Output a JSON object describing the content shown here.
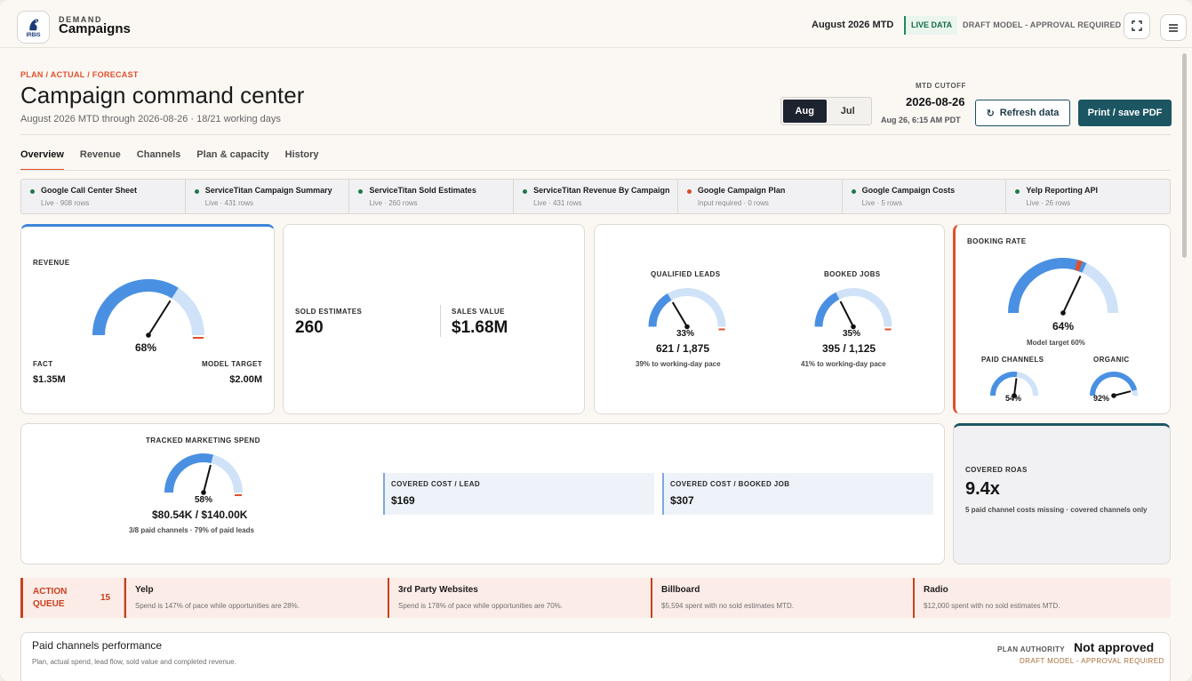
{
  "header": {
    "logo_tag": "IRBIS",
    "brand_small": "DEMAND",
    "brand_big": "Campaigns",
    "period": "August 2026 MTD",
    "live": "LIVE DATA",
    "draft": "DRAFT MODEL - APPROVAL REQUIRED",
    "icons": [
      "fullscreen-icon",
      "menu-icon"
    ]
  },
  "page": {
    "eyebrow": "PLAN / ACTUAL / FORECAST",
    "title": "Campaign command center",
    "subtitle": "August 2026 MTD through 2026-08-26 · 18/21 working days",
    "months": [
      "Aug",
      "Jul"
    ],
    "active_month": "Aug",
    "cutoff_label": "MTD CUTOFF",
    "cutoff_date": "2026-08-26",
    "cutoff_time": "Aug 26, 6:15 AM PDT",
    "refresh_label": "Refresh data",
    "refresh_icon": "↻",
    "print_label": "Print / save PDF"
  },
  "tabs": [
    "Overview",
    "Revenue",
    "Channels",
    "Plan & capacity",
    "History"
  ],
  "active_tab": "Overview",
  "sources": [
    {
      "name": "Google Call Center Sheet",
      "status": "Live · 908 rows",
      "ok": true
    },
    {
      "name": "ServiceTitan Campaign Summary",
      "status": "Live · 431 rows",
      "ok": true
    },
    {
      "name": "ServiceTitan Sold Estimates",
      "status": "Live · 260 rows",
      "ok": true
    },
    {
      "name": "ServiceTitan Revenue By Campaign",
      "status": "Live · 431 rows",
      "ok": true
    },
    {
      "name": "Google Campaign Plan",
      "status": "Input required · 0 rows",
      "ok": false
    },
    {
      "name": "Google Campaign Costs",
      "status": "Live · 5 rows",
      "ok": true
    },
    {
      "name": "Yelp Reporting API",
      "status": "Live · 26 rows",
      "ok": true
    }
  ],
  "revenue": {
    "label": "REVENUE",
    "pct_label": "68%",
    "pct": 0.68,
    "target_mark": 1.0,
    "fact_label": "FACT",
    "fact_value": "$1.35M",
    "target_label": "MODEL TARGET",
    "target_value": "$2.00M"
  },
  "sold": {
    "est_label": "SOLD ESTIMATES",
    "est_value": "260",
    "sales_label": "SALES VALUE",
    "sales_value": "$1.68M"
  },
  "leads": {
    "label": "QUALIFIED LEADS",
    "pct_label": "33%",
    "pct": 0.33,
    "target_mark": 1.0,
    "value": "621 / 1,875",
    "pace": "39% to working-day pace"
  },
  "booked": {
    "label": "BOOKED JOBS",
    "pct_label": "35%",
    "pct": 0.35,
    "target_mark": 1.0,
    "value": "395 / 1,125",
    "pace": "41% to working-day pace"
  },
  "booking_rate": {
    "label": "BOOKING RATE",
    "pct_label": "64%",
    "pct": 0.64,
    "target_mark": 0.6,
    "target": "Model target 60%",
    "paid_label": "PAID CHANNELS",
    "paid_pct_label": "54%",
    "paid_pct": 0.54,
    "organic_label": "ORGANIC",
    "organic_pct_label": "92%",
    "organic_pct": 0.92
  },
  "spend": {
    "label": "TRACKED MARKETING SPEND",
    "pct_label": "58%",
    "pct": 0.58,
    "target_mark": 1.0,
    "value": "$80.54K / $140.00K",
    "note": "3/8 paid channels · 79% of paid leads",
    "cpl_label": "COVERED COST / LEAD",
    "cpl_value": "$169",
    "cpb_label": "COVERED COST / BOOKED JOB",
    "cpb_value": "$307"
  },
  "roas": {
    "label": "COVERED ROAS",
    "value": "9.4x",
    "note": "5 paid channel costs missing · covered channels only"
  },
  "action_queue": {
    "title": "ACTION QUEUE",
    "count": "15",
    "items": [
      {
        "title": "Yelp",
        "desc": "Spend is 147% of pace while opportunities are 28%."
      },
      {
        "title": "3rd Party Websites",
        "desc": "Spend is 178% of pace while opportunities are 70%."
      },
      {
        "title": "Billboard",
        "desc": "$5,594 spent with no sold estimates MTD."
      },
      {
        "title": "Radio",
        "desc": "$12,000 spent with no sold estimates MTD."
      }
    ]
  },
  "paid_panel": {
    "title": "Paid channels performance",
    "subtitle": "Plan, actual spend, lead flow, sold value and completed revenue.",
    "authority_label": "PLAN AUTHORITY",
    "authority_value": "Not approved",
    "authority_note": "DRAFT MODEL - APPROVAL REQUIRED"
  },
  "colors": {
    "accent_orange": "#e0502a",
    "gauge_fill": "#4a90e2",
    "gauge_track": "#cfe2f7",
    "teal": "#1d5663",
    "green": "#1f7a4a"
  }
}
